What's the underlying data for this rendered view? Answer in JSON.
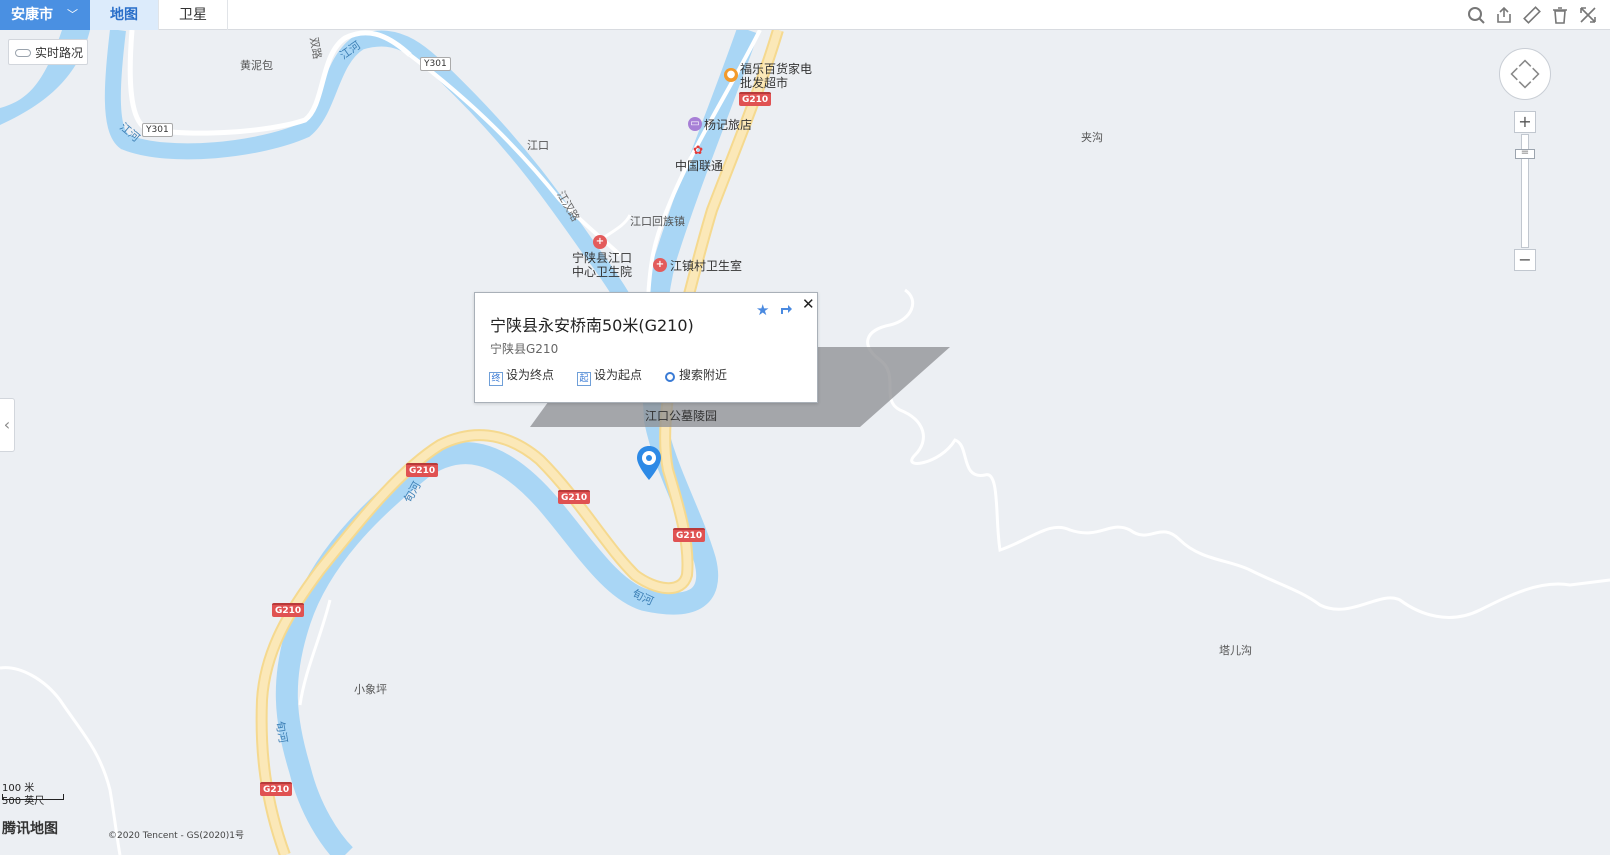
{
  "topbar": {
    "city": "安康市",
    "tabs": [
      {
        "label": "地图",
        "active": true
      },
      {
        "label": "卫星",
        "active": false
      }
    ],
    "tools": [
      "search-area-icon",
      "share-icon",
      "ruler-icon",
      "trash-icon",
      "fullscreen-icon"
    ]
  },
  "traffic_toggle": {
    "label": "实时路况"
  },
  "map_labels": {
    "huangnibao": "黄泥包",
    "jiangkou": "江口",
    "jiangkou_town": "江口回族镇",
    "jiahou": "夹沟",
    "taergou": "塔儿沟",
    "xiaoxiangping": "小象坪",
    "jianghan_road": "江汉路",
    "shuang_road": "双路",
    "river_jiang_1": "江河",
    "river_jiang_2": "江河",
    "river_xun_1": "旬河",
    "river_xun_2": "旬河",
    "river_xun_3": "旬河"
  },
  "pois": {
    "supermarket": {
      "line1": "福乐百货家电",
      "line2": "批发超市"
    },
    "hotel": "杨记旅店",
    "unicom": "中国联通",
    "hospital": {
      "line1": "宁陕县江口",
      "line2": "中心卫生院"
    },
    "clinic": "江镇村卫生室",
    "cemetery": "江口公墓陵园"
  },
  "road_shields": {
    "y301_a": "Y301",
    "y301_b": "Y301",
    "g210_a": "G210",
    "g210_b": "G210",
    "g210_c": "G210",
    "g210_d": "G210",
    "g210_e": "G210",
    "g210_f": "G210"
  },
  "popup": {
    "title": "宁陕县永安桥南50米(G210)",
    "subtitle": "宁陕县G210",
    "actions": {
      "set_end": "设为终点",
      "set_start": "设为起点",
      "search_nearby": "搜索附近"
    },
    "end_glyph": "终",
    "start_glyph": "起",
    "close": "✕"
  },
  "zoom": {
    "in": "+",
    "out": "−",
    "thumb": "="
  },
  "scale": {
    "meters": "100 米",
    "feet": "500 英尺"
  },
  "logo": "腾讯地图",
  "copyright": "©2020 Tencent - GS(2020)1号",
  "colors": {
    "river": "#a9d6f5",
    "road_major": "#fbe3a5",
    "road_minor": "#ffffff",
    "land": "#eceff3",
    "accent": "#4a90e2",
    "shield": "#e05252"
  }
}
